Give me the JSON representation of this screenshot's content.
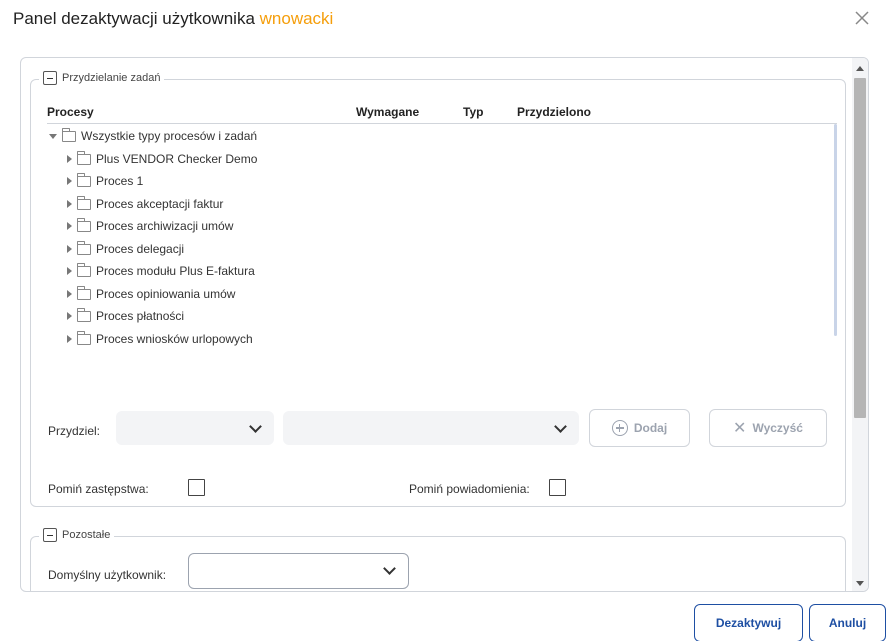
{
  "dialog": {
    "title_prefix": "Panel dezaktywacji użytkownika",
    "title_user": "wnowacki",
    "accent_color": "#f59e0b"
  },
  "assign_section": {
    "legend": "Przydzielanie zadań",
    "columns": [
      "Procesy",
      "Wymagane",
      "Typ",
      "Przydzielono"
    ],
    "tree_root": "Wszystkie typy procesów i zadań",
    "tree_items": [
      "Plus VENDOR Checker Demo",
      "Proces 1",
      "Proces akceptacji faktur",
      "Proces archiwizacji umów",
      "Proces delegacji",
      "Proces modułu Plus E-faktura",
      "Proces opiniowania umów",
      "Proces płatności",
      "Proces wniosków urlopowych"
    ],
    "assign_label": "Przydziel:",
    "add_label": "Dodaj",
    "clear_label": "Wyczyść",
    "skip_substitutions_label": "Pomiń zastępstwa:",
    "skip_notifications_label": "Pomiń powiadomienia:"
  },
  "other_section": {
    "legend": "Pozostałe",
    "default_user_label": "Domyślny użytkownik:"
  },
  "footer": {
    "deactivate_label": "Dezaktywuj",
    "cancel_label": "Anuluj",
    "primary_color": "#1e4fa3"
  }
}
